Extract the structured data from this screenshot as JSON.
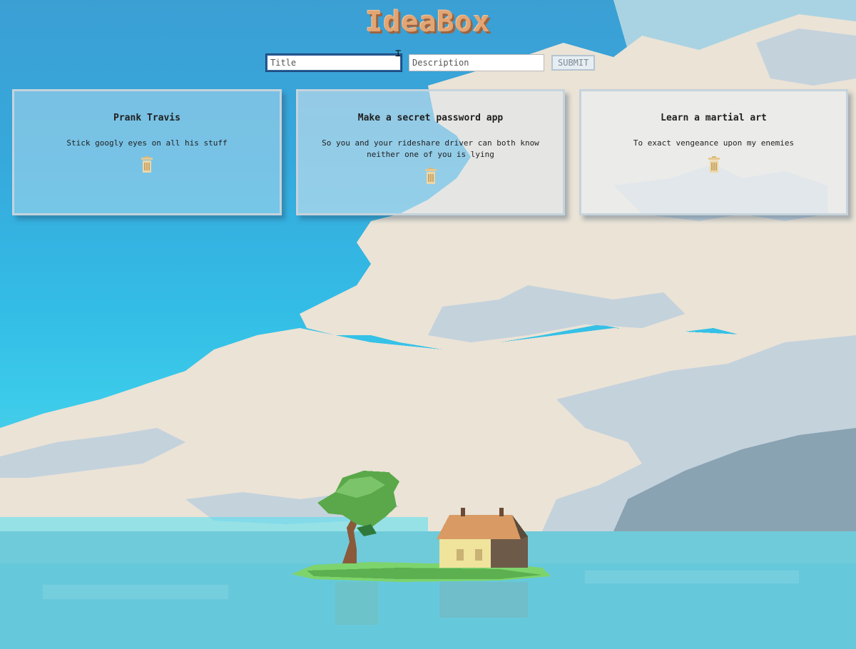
{
  "app": {
    "title": "IdeaBox"
  },
  "form": {
    "title_placeholder": "Title",
    "title_value": "",
    "description_placeholder": "Description",
    "description_value": "",
    "submit_label": "SUBMIT"
  },
  "ideas": [
    {
      "title": "Prank Travis",
      "body": "Stick googly eyes on all his stuff",
      "delete_icon": "trash-icon"
    },
    {
      "title": "Make a secret password app",
      "body": "So you and your rideshare driver can both know neither one of you is lying",
      "delete_icon": "trash-icon"
    },
    {
      "title": "Learn a martial art",
      "body": "To exact vengeance upon my enemies",
      "delete_icon": "trash-icon"
    }
  ],
  "colors": {
    "title_text": "#e2a574",
    "sky": "#36a9dc",
    "cloud": "#ece5d8",
    "trash_icon": "#e6c98f"
  }
}
